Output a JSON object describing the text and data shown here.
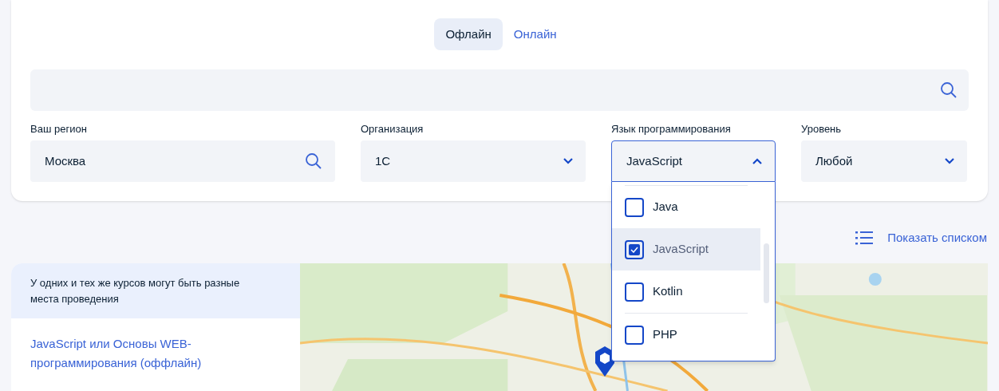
{
  "tabs": [
    {
      "label": "Офлайн",
      "selected": true
    },
    {
      "label": "Онлайн",
      "selected": false
    }
  ],
  "filters": [
    {
      "label": "Ваш регион",
      "value": "Москва",
      "kind": "search",
      "expanded": false
    },
    {
      "label": "Организация",
      "value": "1С",
      "kind": "select",
      "expanded": false
    },
    {
      "label": "Язык программирования",
      "value": "JavaScript",
      "kind": "select",
      "expanded": true
    },
    {
      "label": "Уровень",
      "value": "Любой",
      "kind": "select",
      "expanded": false
    }
  ],
  "dropdown_options": [
    {
      "label": "Java",
      "checked": false,
      "selected": false
    },
    {
      "label": "JavaScript",
      "checked": true,
      "selected": true
    },
    {
      "label": "Kotlin",
      "checked": false,
      "selected": false
    },
    {
      "label": "PHP",
      "checked": false,
      "selected": false
    }
  ],
  "show_list_link": "Показать списком",
  "notice": "У одних и тех же курсов могут быть разные места проведения",
  "courses": [
    {
      "title": "JavaScript или Основы WEB-программирования (оффлайн)"
    }
  ]
}
